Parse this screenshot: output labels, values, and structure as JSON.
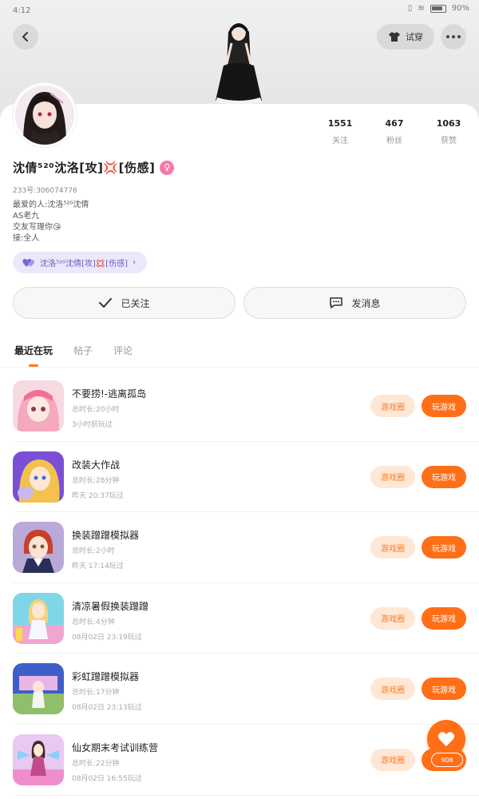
{
  "status_bar": {
    "time": "4:12",
    "battery": "90%"
  },
  "header": {
    "dressup_label": "试穿",
    "accent_color": "#ff6f17"
  },
  "profile": {
    "username": "沈倩⁵²⁰沈洛[攻]💢[伤感]",
    "uid": "233号:306074776",
    "bio": [
      "最爱的人:沈洛⁵²⁰沈倩",
      "AS老九",
      "交友写理你😘",
      "接:全人"
    ],
    "group_chip": "沈洛⁵²⁰沈倩[攻]💢[伤感]",
    "stats": [
      {
        "value": "1551",
        "label": "关注"
      },
      {
        "value": "467",
        "label": "粉丝"
      },
      {
        "value": "1063",
        "label": "获赞"
      }
    ]
  },
  "actions": {
    "followed": "已关注",
    "message": "发消息"
  },
  "tabs": [
    {
      "label": "最近在玩",
      "active": true
    },
    {
      "label": "帖子",
      "active": false
    },
    {
      "label": "评论",
      "active": false
    }
  ],
  "games": [
    {
      "name": "不要捞!-逃离孤岛",
      "duration": "总时长:20小时",
      "last_played": "3小时前玩过",
      "circle_label": "游戏圈",
      "play_label": "玩游戏"
    },
    {
      "name": "改装大作战",
      "duration": "总时长:28分钟",
      "last_played": "昨天 20:37玩过",
      "circle_label": "游戏圈",
      "play_label": "玩游戏"
    },
    {
      "name": "换装蹭蹭模拟器",
      "duration": "总时长:2小时",
      "last_played": "昨天 17:14玩过",
      "circle_label": "游戏圈",
      "play_label": "玩游戏"
    },
    {
      "name": "清凉暑假换装蹭蹭",
      "duration": "总时长:4分钟",
      "last_played": "08月02日 23:19玩过",
      "circle_label": "游戏圈",
      "play_label": "玩游戏"
    },
    {
      "name": "彩虹蹭蹭模拟器",
      "duration": "总时长:17分钟",
      "last_played": "08月02日 23:13玩过",
      "circle_label": "游戏圈",
      "play_label": "玩游戏"
    },
    {
      "name": "仙女期末考试训练营",
      "duration": "总时长:22分钟",
      "last_played": "08月02日 16:55玩过",
      "circle_label": "游戏圈",
      "play_label": "玩游戏"
    }
  ],
  "float": {
    "like_count": "908"
  }
}
